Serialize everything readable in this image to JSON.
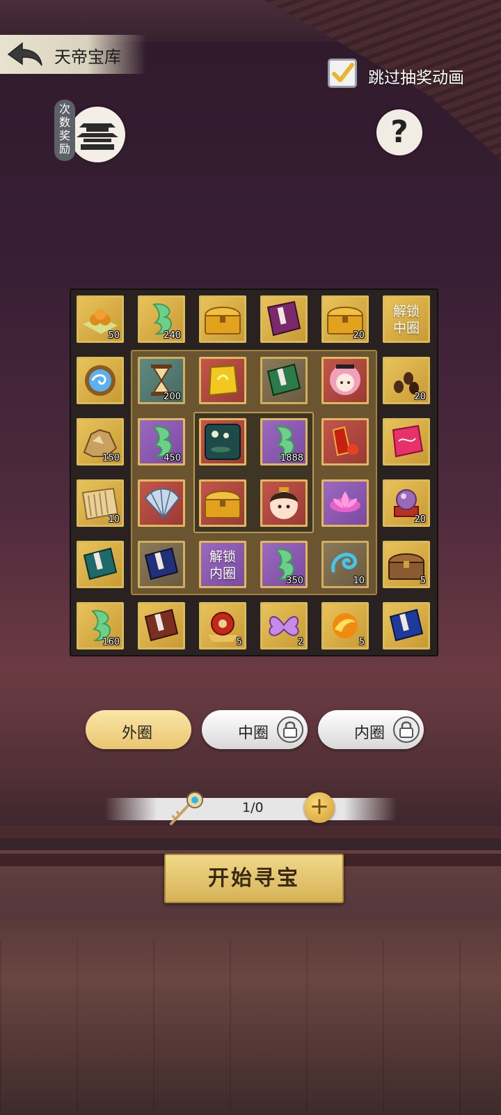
{
  "header": {
    "title": "天帝宝库"
  },
  "skip_animation": {
    "label": "跳过抽奖动画",
    "checked": true
  },
  "reward": {
    "tag": "次数奖励"
  },
  "help": {
    "glyph": "?"
  },
  "outer_ring": {
    "top_row": [
      {
        "item": "gold-ingots-icon",
        "count": "50"
      },
      {
        "item": "jade-ruyi-icon",
        "count": "240"
      },
      {
        "item": "golden-chest-icon",
        "count": ""
      },
      {
        "item": "purple-book-icon",
        "count": ""
      },
      {
        "item": "golden-chest-icon",
        "count": "20"
      },
      {
        "item": "unlock-middle",
        "label": "解锁中圈"
      }
    ],
    "left_column": [
      {
        "item": "blue-swirl-orb-icon",
        "count": ""
      },
      {
        "item": "gold-ore-icon",
        "count": "150"
      },
      {
        "item": "scroll-icon",
        "count": "10"
      },
      {
        "item": "teal-book-icon",
        "count": ""
      }
    ],
    "right_column": [
      {
        "item": "seeds-icon",
        "count": "20"
      },
      {
        "item": "pink-gem-icon",
        "count": ""
      },
      {
        "item": "crystal-ball-icon",
        "count": "20"
      },
      {
        "item": "wooden-chest-icon",
        "count": "5"
      }
    ],
    "bottom_row": [
      {
        "item": "jade-ruyi-icon",
        "count": "160"
      },
      {
        "item": "brown-book-icon",
        "count": ""
      },
      {
        "item": "red-orb-icon",
        "count": "5"
      },
      {
        "item": "butterfly-icon",
        "count": "2"
      },
      {
        "item": "fire-orb-icon",
        "count": "5"
      },
      {
        "item": "blue-book-icon",
        "count": ""
      }
    ]
  },
  "middle_ring": {
    "cells": [
      {
        "item": "hourglass-icon",
        "count": "200"
      },
      {
        "item": "gold-token-icon",
        "count": ""
      },
      {
        "item": "green-book-icon",
        "count": ""
      },
      {
        "item": "pink-hair-girl-avatar-icon",
        "count": ""
      },
      {
        "item": "jade-ruyi-icon",
        "count": "450"
      },
      {
        "item": "red-talisman-icon",
        "count": ""
      },
      {
        "item": "silver-fan-icon",
        "count": ""
      },
      {
        "item": "pink-lotus-icon",
        "count": ""
      },
      {
        "item": "navy-book-icon",
        "count": ""
      },
      {
        "item": "unlock-inner",
        "label": "解锁内圈"
      },
      {
        "item": "jade-ruyi-icon",
        "count": "350"
      },
      {
        "item": "water-swirl-icon",
        "count": "10"
      }
    ]
  },
  "inner_ring": {
    "cells": [
      {
        "item": "lotus-pond-painting-icon",
        "count": ""
      },
      {
        "item": "jade-ruyi-icon",
        "count": "1888"
      },
      {
        "item": "golden-chest-icon",
        "count": ""
      },
      {
        "item": "boy-avatar-icon",
        "count": ""
      }
    ]
  },
  "tabs": [
    {
      "label": "外圈",
      "state": "selected"
    },
    {
      "label": "中圈",
      "locked": true
    },
    {
      "label": "内圈",
      "locked": true
    }
  ],
  "keys": {
    "count": "1/0",
    "add_glyph": "+"
  },
  "start_button": {
    "label": "开始寻宝"
  },
  "colors": {
    "gold": "#e8c25a",
    "tab_active": "#f4d890",
    "tab_inactive": "#f0f0f0",
    "board_bg": "#2a2220"
  }
}
